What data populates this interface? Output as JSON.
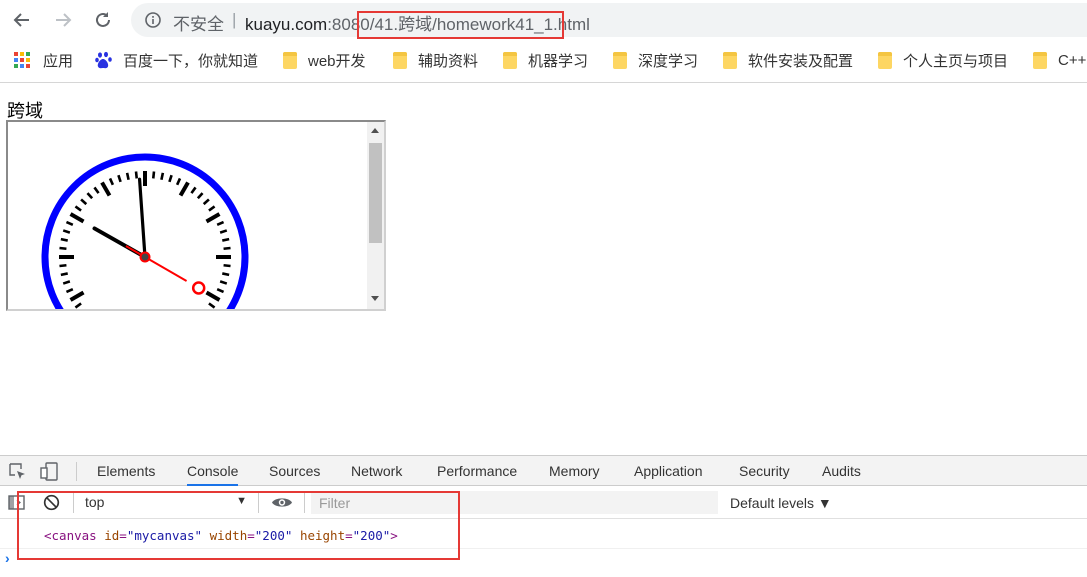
{
  "browser": {
    "security_label": "不安全",
    "separator": "|",
    "url_host": "kuayu.com",
    "url_rest": ":8080/41.跨域/homework41_1.html"
  },
  "bookmarks": {
    "apps": "应用",
    "baidu": "百度一下，你就知道",
    "items": [
      "web开发",
      "辅助资料",
      "机器学习",
      "深度学习",
      "软件安装及配置",
      "个人主页与项目",
      "C++"
    ]
  },
  "page": {
    "heading": "跨域"
  },
  "clock": {
    "face_color": "#0000ff",
    "hand_color": "#000000",
    "second_hand_color": "#ff0000",
    "hour": 9,
    "minute": 59,
    "second": 20
  },
  "devtools": {
    "tabs": [
      "Elements",
      "Console",
      "Sources",
      "Network",
      "Performance",
      "Memory",
      "Application",
      "Security",
      "Audits"
    ],
    "active_tab": "Console",
    "context": "top",
    "filter_placeholder": "Filter",
    "levels": "Default levels ▼",
    "prompt": "›",
    "log": {
      "open": "<canvas",
      "attr1_name": "id",
      "attr1_value": "\"mycanvas\"",
      "attr2_name": "width",
      "attr2_value": "\"200\"",
      "attr3_name": "height",
      "attr3_value": "\"200\"",
      "close": ">",
      "equals": "="
    }
  }
}
